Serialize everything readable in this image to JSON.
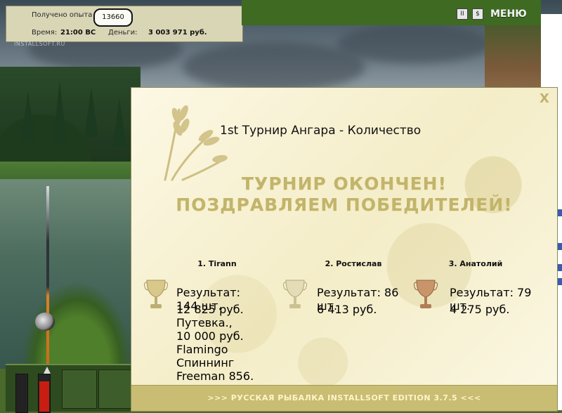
{
  "hud": {
    "exp_label": "Получено опыта",
    "exp_value": "13660",
    "time_label": "Время:",
    "time_value": "21:00 ВС",
    "money_label": "Деньги:",
    "money_value": "3 003 971 руб."
  },
  "watermark": "INSTALLSOFT.RU",
  "topbar": {
    "pause_glyph": "II",
    "dollar_glyph": "$",
    "menu_label": "МЕНЮ"
  },
  "dialog": {
    "close_glyph": "X",
    "title": "1st Турнир Ангара - Количество",
    "headline_line1": "ТУРНИР ОКОНЧЕН!",
    "headline_line2": "ПОЗДРАВЛЯЕМ ПОБЕДИТЕЛЕЙ!",
    "winners": [
      {
        "name": "1. Tirann",
        "result": "Результат: 144 шт.",
        "prize_lines": [
          "12 825 руб. Путевка.,",
          "10 000 руб. Flamingo",
          "Спиннинг Freeman 856."
        ],
        "trophy_color": "#d8c88a"
      },
      {
        "name": "2. Ростислав",
        "result": "Результат: 86 шт.",
        "prize_lines": [
          "6 413 руб."
        ],
        "trophy_color": "#ddd3a3"
      },
      {
        "name": "3. Анатолий",
        "result": "Результат: 79 шт.",
        "prize_lines": [
          "4 275 руб."
        ],
        "trophy_color": "#c8956a"
      }
    ],
    "footer": ">>> РУССКАЯ РЫБАЛКА INSTALLSOFT EDITION 3.7.5 <<<"
  },
  "colors": {
    "accent_green": "#3e6a22",
    "headline_gold": "#c2b46a",
    "dialog_bg": "#fbf6e0"
  },
  "meters": [
    {
      "fill_fraction": 0.8
    }
  ]
}
